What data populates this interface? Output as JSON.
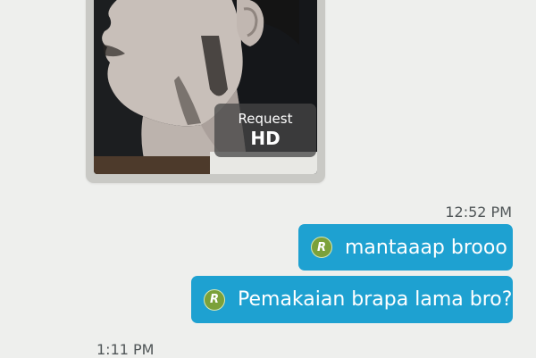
{
  "photo_message": {
    "hd_button": {
      "line1": "Request",
      "line2": "HD"
    }
  },
  "timestamps": {
    "outgoing": "12:52 PM",
    "next": "1:11 PM"
  },
  "messages": [
    {
      "badge": "R",
      "text": "mantaaap brooo"
    },
    {
      "badge": "R",
      "text": "Pemakaian brapa lama bro?"
    }
  ],
  "colors": {
    "background": "#eeefed",
    "outgoing_bubble": "#1ea1d1",
    "read_badge": "#7ba13a",
    "hd_overlay": "rgba(70,70,70,0.76)"
  },
  "icons": {
    "read_badge": "r-status-badge"
  }
}
